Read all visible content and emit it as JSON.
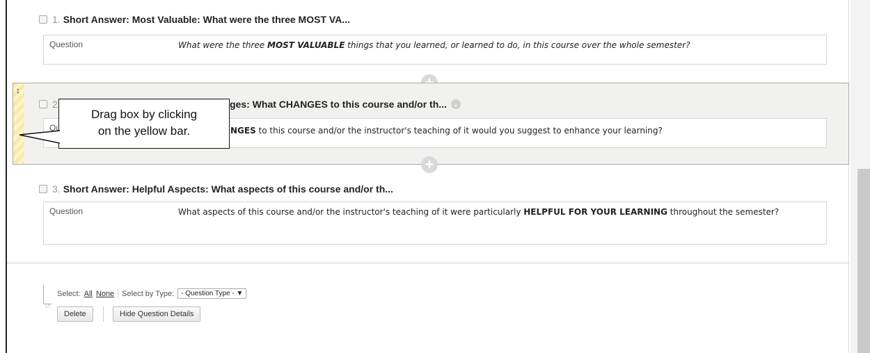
{
  "questions": [
    {
      "number": "1.",
      "title": "Short Answer: Most Valuable: What were the three MOST VA...",
      "label": "Question",
      "text_before": "What were the three ",
      "text_bold": "MOST VALUABLE",
      "text_after": " things that you learned, or learned to do, in this course over the whole semester?"
    },
    {
      "number": "2",
      "title_visible": "ges: What CHANGES to this course and/or th...",
      "label_visible": "Qu",
      "text_bold_visible": "NGES",
      "text_after": " to this course and/or the instructor's teaching of it would you suggest to enhance your learning?"
    },
    {
      "number": "3.",
      "title": "Short Answer: Helpful Aspects: What aspects of this course and/or th...",
      "label": "Question",
      "text_before": "What aspects of this course and/or the instructor's teaching of it were particularly ",
      "text_bold": "HELPFUL FOR YOUR LEARNING",
      "text_after": " throughout the semester?"
    }
  ],
  "callout": {
    "line1": "Drag box by clicking",
    "line2": "on the yellow bar."
  },
  "icons": {
    "plus": "+",
    "chevron": "⌄",
    "drag": "↕"
  },
  "footer": {
    "select_label": "Select:",
    "all": "All",
    "none": "None",
    "select_by_type": "Select by Type:",
    "question_type": "- Question Type - ▼",
    "delete": "Delete",
    "hide_details": "Hide Question Details"
  },
  "colors": {
    "drag_bar": "#f7e9a8",
    "selected_bg": "#f1f1ef"
  }
}
